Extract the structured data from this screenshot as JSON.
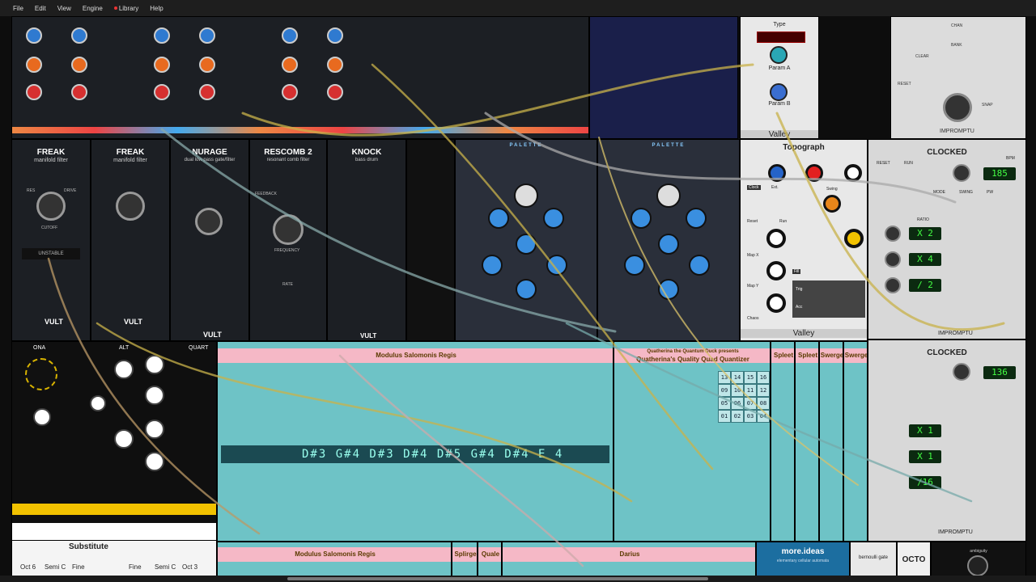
{
  "menu": {
    "file": "File",
    "edit": "Edit",
    "view": "View",
    "engine": "Engine",
    "library": "Library",
    "help": "Help"
  },
  "modules": {
    "freak1": {
      "title": "FREAK",
      "sub": "manifold filter",
      "brand": "VULT",
      "res": "RES",
      "drive": "DRIVE",
      "cutoff": "CUTOFF",
      "display": "UNSTABLE"
    },
    "freak2": {
      "title": "FREAK",
      "sub": "manifold filter",
      "brand": "VULT"
    },
    "nurage": {
      "title": "NURAGE",
      "sub": "dual low pass gate/filter",
      "brand": "VULT"
    },
    "rescomb": {
      "title": "RESCOMB 2",
      "sub": "resonant comb filter",
      "feedback": "FEEDBACK",
      "frequency": "FREQUENCY",
      "rate": "RATE"
    },
    "knock": {
      "title": "KNOCK",
      "sub": "bass drum",
      "brand": "VULT"
    },
    "palette1": {
      "title": "PALETTE"
    },
    "palette2": {
      "title": "PALETTE"
    },
    "valley_top": {
      "title": "Valley",
      "type": "Type",
      "param_a": "Param A",
      "param_b": "Param B"
    },
    "topograph": {
      "title": "Topograph",
      "clock": "Clock",
      "ext": "Ext.",
      "swing": "Swing",
      "reset": "Reset",
      "run": "Run",
      "mapx": "Map X",
      "mapy": "Map Y",
      "chaos": "Chaos",
      "fill": "Fill",
      "trig": "Trig",
      "acc": "Acc",
      "brand": "Valley"
    },
    "clocked1": {
      "title": "CLOCKED",
      "bpm_label": "BPM",
      "bpm": "185",
      "reset": "RESET",
      "run": "RUN",
      "mode": "MODE",
      "swing": "SWING",
      "pw": "PW",
      "ratio": "RATIO",
      "r1": "X 2",
      "r2": "X 4",
      "r3": "/ 2",
      "brand": "IMPROMPTU"
    },
    "clocked2": {
      "title": "CLOCKED",
      "bpm": "136",
      "r1": "X 1",
      "r2": "X 1",
      "r3": "/16",
      "brand": "IMPROMPTU"
    },
    "impromptu_top": {
      "chan": "CHAN",
      "bank": "BANK",
      "clear": "CLEAR",
      "reset": "RESET",
      "snap": "SNAP",
      "brand": "IMPROMPTU"
    },
    "modulus": {
      "title": "Modulus Salomonis Regis",
      "seq": "D#3  G#4  D#3  D#4  D#5  G#4  D#4  E 4"
    },
    "quatherina": {
      "subtitle": "Quatherina the Quantum Duck presents",
      "title": "Quatherina's Quality Quad Quantizer",
      "grid": [
        "13",
        "14",
        "15",
        "16",
        "09",
        "10",
        "11",
        "12",
        "05",
        "06",
        "07",
        "08",
        "01",
        "02",
        "03",
        "04"
      ]
    },
    "spleet1": {
      "title": "Spleet"
    },
    "spleet2": {
      "title": "Spleet"
    },
    "swerge1": {
      "title": "Swerge"
    },
    "swerge2": {
      "title": "Swerge"
    },
    "substitute": {
      "title": "Substitute",
      "ona": "ONA",
      "alt": "ALT",
      "quart": "QUART",
      "oct": "Oct 6",
      "semi": "Semi C",
      "fine": "Fine",
      "fine2": "Fine",
      "semi2": "Semi C",
      "oct2": "Oct 3"
    },
    "bottom": {
      "modulus2": "Modulus Salomonis Regis",
      "splirge": "Splirge",
      "quale": "Quale",
      "darius": "Darius",
      "moreideas": "more.ideas",
      "moreideas_sub": "elementary cellular automata",
      "bernoulli": "bernoulli gate",
      "octo": "OCTO",
      "ambiguity": "ambiguity"
    }
  },
  "colors": {
    "vult_bg": "#1c1f24",
    "teal": "#6ec3c6",
    "pink": "#f5b8c6",
    "palette_bg": "#2a2f3a",
    "blue_knob": "#3a8fe0",
    "gold": "#d9b400",
    "impromptu_bg": "#d8d8d8"
  },
  "view": {
    "zoom": "100"
  }
}
